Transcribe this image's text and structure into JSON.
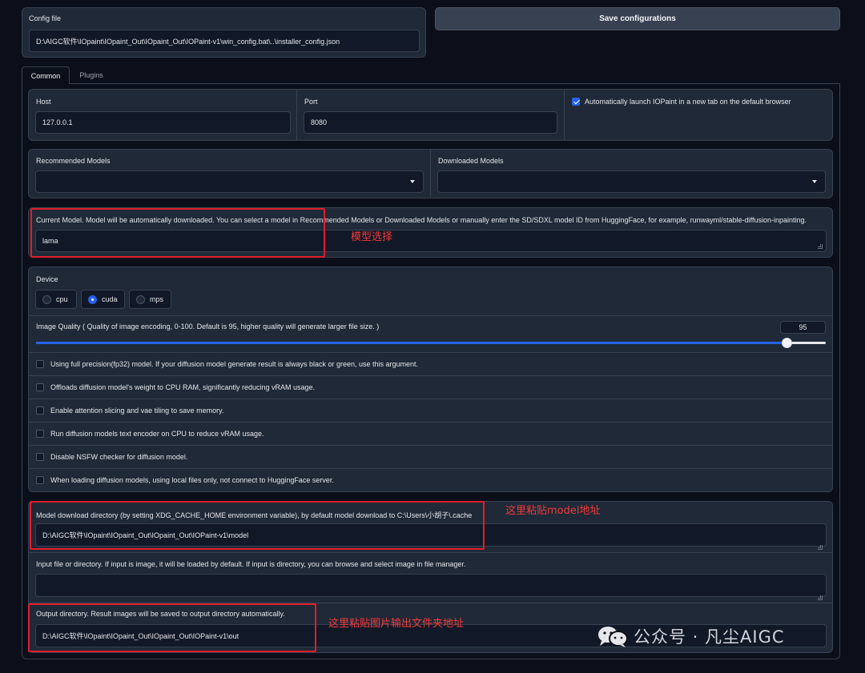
{
  "config": {
    "label": "Config file",
    "path": "D:\\AIGC软件\\IOpaint\\IOpaint_Out\\IOpaint_Out\\IOPaint-v1\\win_config.bat\\..\\installer_config.json"
  },
  "save_button_label": "Save configurations",
  "tabs": [
    {
      "label": "Common",
      "active": true
    },
    {
      "label": "Plugins",
      "active": false
    }
  ],
  "host": {
    "label": "Host",
    "value": "127.0.0.1"
  },
  "port": {
    "label": "Port",
    "value": "8080"
  },
  "auto_launch": {
    "label": "Automatically launch IOPaint in a new tab on the default browser",
    "checked": true
  },
  "recommended_models": {
    "label": "Recommended Models",
    "value": ""
  },
  "downloaded_models": {
    "label": "Downloaded Models",
    "value": ""
  },
  "current_model": {
    "label": "Current Model. Model will be automatically downloaded. You can select a model in Recommended Models or Downloaded Models or manually enter the SD/SDXL model ID from HuggingFace, for example, runwayml/stable-diffusion-inpainting.",
    "value": "lama"
  },
  "device": {
    "label": "Device",
    "options": [
      "cpu",
      "cuda",
      "mps"
    ],
    "selected": "cuda"
  },
  "image_quality": {
    "label": "Image Quality ( Quality of image encoding, 0-100. Default is 95, higher quality will generate larger file size. )",
    "value": "95",
    "min": 0,
    "max": 100,
    "fraction": 0.95
  },
  "checkboxes": [
    {
      "label": "Using full precision(fp32) model. If your diffusion model generate result is always black or green, use this argument.",
      "checked": false
    },
    {
      "label": "Offloads diffusion model's weight to CPU RAM, significantly reducing vRAM usage.",
      "checked": false
    },
    {
      "label": "Enable attention slicing and vae tiling to save memory.",
      "checked": false
    },
    {
      "label": "Run diffusion models text encoder on CPU to reduce vRAM usage.",
      "checked": false
    },
    {
      "label": "Disable NSFW checker for diffusion model.",
      "checked": false
    },
    {
      "label": "When loading diffusion models, using local files only, not connect to HuggingFace server.",
      "checked": false
    }
  ],
  "model_dir": {
    "label": "Model download directory (by setting XDG_CACHE_HOME environment variable), by default model download to C:\\Users\\小胡子\\.cache",
    "value": "D:\\AIGC软件\\IOpaint\\IOpaint_Out\\IOpaint_Out\\IOPaint-v1\\model"
  },
  "input": {
    "label": "Input file or directory. If input is image, it will be loaded by default. If input is directory, you can browse and select image in file manager.",
    "value": ""
  },
  "output_dir": {
    "label": "Output directory. Result images will be saved to output directory automatically.",
    "value": "D:\\AIGC软件\\IOpaint\\IOpaint_Out\\IOpaint_Out\\IOPaint-v1\\out"
  },
  "annotations": {
    "model_select": "模型选择",
    "paste_model": "这里粘贴model地址",
    "paste_output": "这里粘贴图片输出文件夹地址"
  },
  "watermark": "公众号 · 凡尘AIGC",
  "colors": {
    "background": "#0b0f19",
    "panel": "#1f2937",
    "accent": "#2563eb",
    "annotation_red": "#e11d2a"
  }
}
